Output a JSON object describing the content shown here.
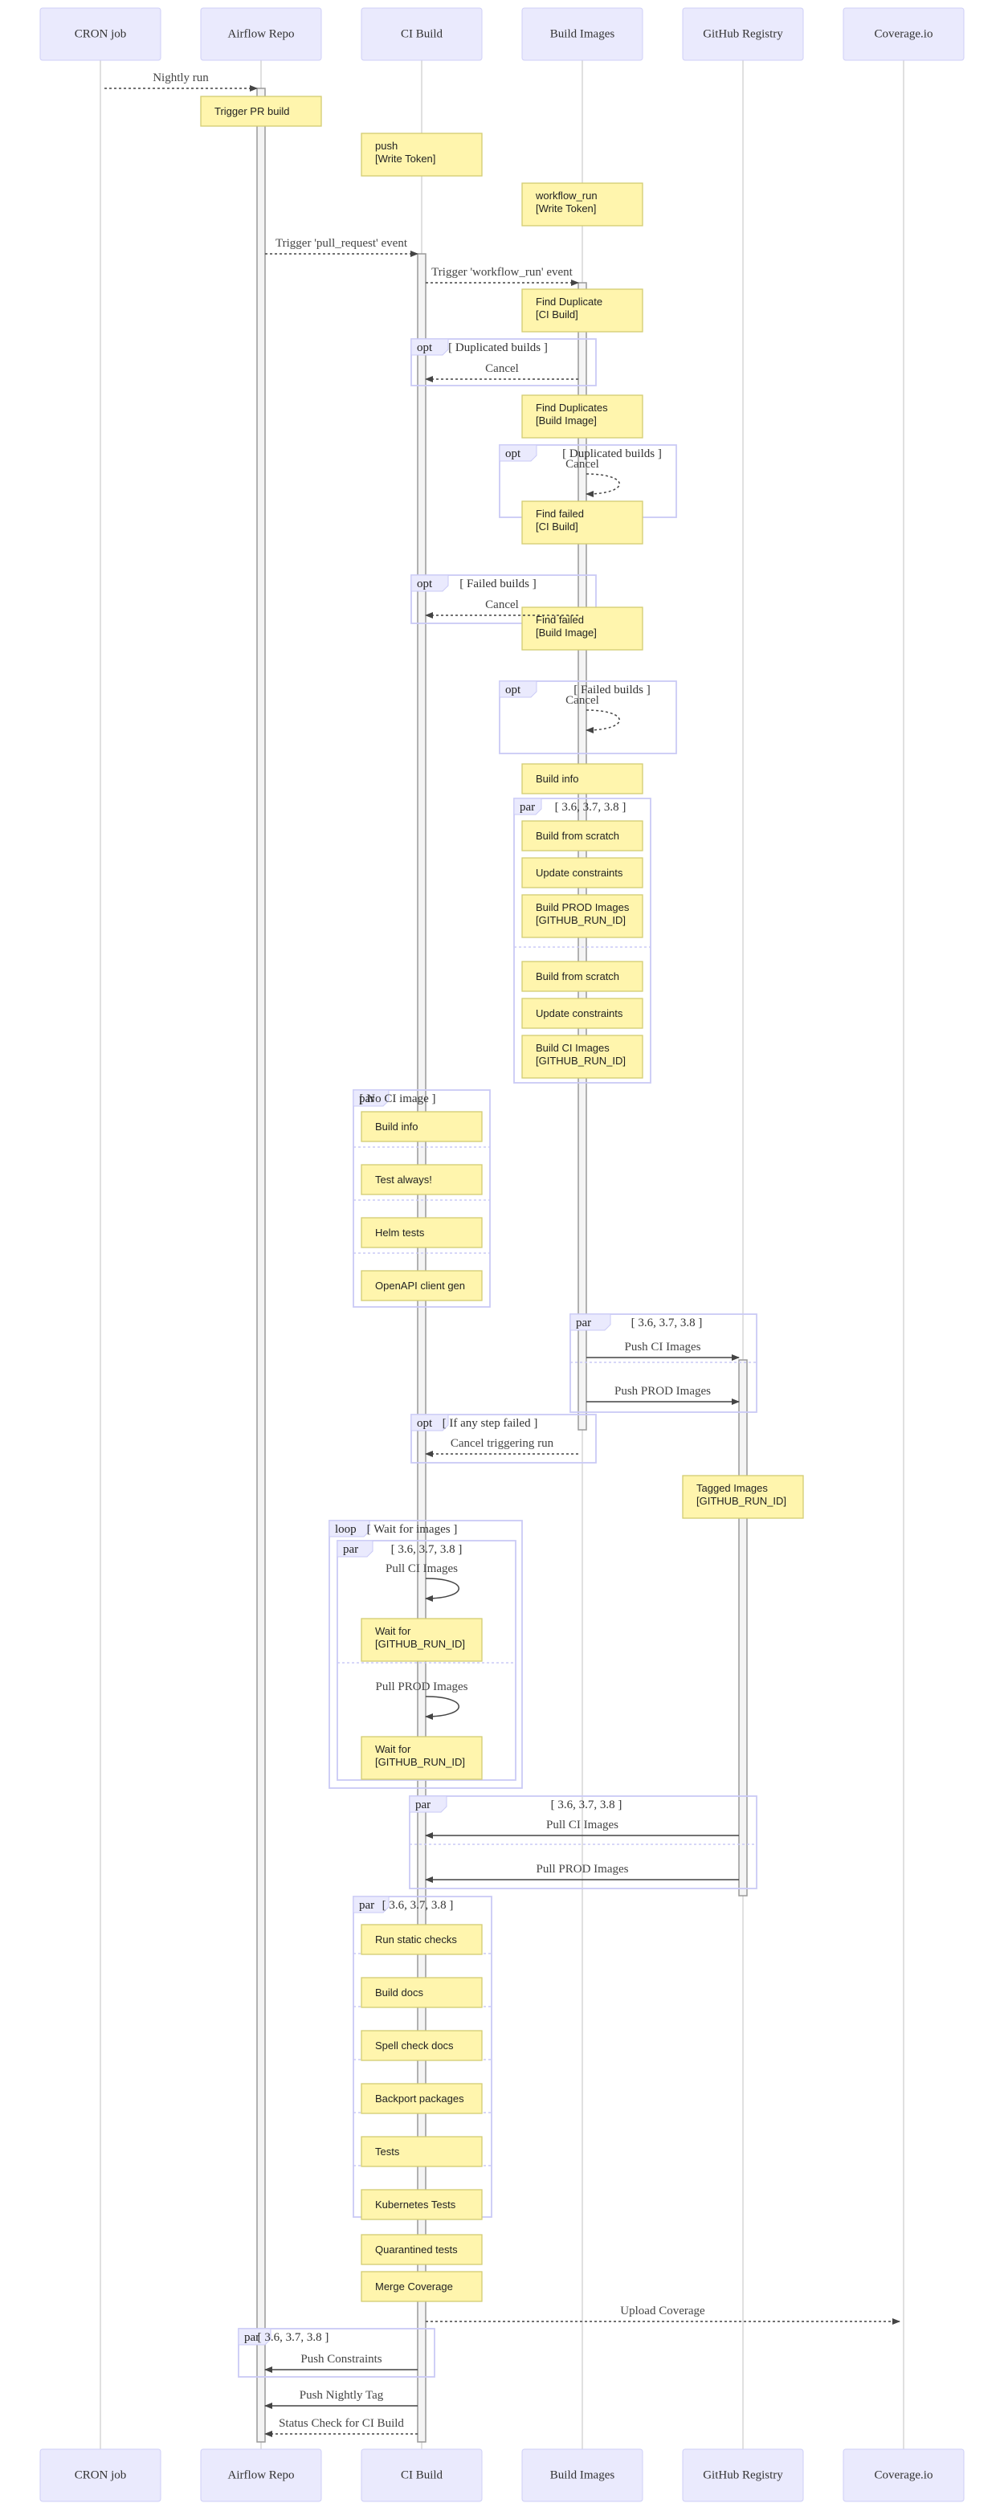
{
  "diagram": {
    "type": "sequence",
    "participants": [
      {
        "id": "cron",
        "label": "CRON job"
      },
      {
        "id": "repo",
        "label": "Airflow Repo"
      },
      {
        "id": "ci",
        "label": "CI Build"
      },
      {
        "id": "img",
        "label": "Build Images"
      },
      {
        "id": "reg",
        "label": "GitHub Registry"
      },
      {
        "id": "cov",
        "label": "Coverage.io"
      }
    ],
    "colors": {
      "actor_fill": "#eaeafd",
      "note_fill": "#fff5ad",
      "frame_stroke": "#cacaf6",
      "message_line": "#444444"
    },
    "messages": [
      {
        "from": "cron",
        "to": "repo",
        "label": "Nightly run",
        "style": "dotted"
      },
      {
        "from": "repo",
        "to": "ci",
        "label": "Trigger 'pull_request' event",
        "style": "dotted"
      },
      {
        "from": "ci",
        "to": "img",
        "label": "Trigger 'workflow_run' event",
        "style": "dotted"
      },
      {
        "from": "img",
        "to": "ci",
        "label": "Cancel",
        "style": "dotted"
      },
      {
        "from": "img",
        "to": "img",
        "label": "Cancel",
        "style": "dotted"
      },
      {
        "from": "img",
        "to": "ci",
        "label": "Cancel",
        "style": "dotted"
      },
      {
        "from": "img",
        "to": "img",
        "label": "Cancel",
        "style": "dotted"
      },
      {
        "from": "img",
        "to": "reg",
        "label": "Push CI Images",
        "style": "solid"
      },
      {
        "from": "img",
        "to": "reg",
        "label": "Push PROD Images",
        "style": "solid"
      },
      {
        "from": "img",
        "to": "ci",
        "label": "Cancel triggering run",
        "style": "dotted"
      },
      {
        "from": "ci",
        "to": "ci",
        "label": "Pull CI Images",
        "style": "solid"
      },
      {
        "from": "ci",
        "to": "ci",
        "label": "Pull PROD Images",
        "style": "solid"
      },
      {
        "from": "reg",
        "to": "ci",
        "label": "Pull CI Images",
        "style": "solid"
      },
      {
        "from": "reg",
        "to": "ci",
        "label": "Pull PROD Images",
        "style": "solid"
      },
      {
        "from": "ci",
        "to": "cov",
        "label": "Upload Coverage",
        "style": "dotted"
      },
      {
        "from": "ci",
        "to": "repo",
        "label": "Push Constraints",
        "style": "solid"
      },
      {
        "from": "ci",
        "to": "repo",
        "label": "Push Nightly Tag",
        "style": "solid"
      },
      {
        "from": "ci",
        "to": "repo",
        "label": "Status Check for CI Build",
        "style": "dotted"
      }
    ],
    "notes": [
      {
        "over": "repo",
        "lines": [
          "Trigger PR build"
        ]
      },
      {
        "over": "ci",
        "lines": [
          "push",
          "[Write Token]"
        ]
      },
      {
        "over": "img",
        "lines": [
          "workflow_run",
          "[Write Token]"
        ]
      },
      {
        "over": "img",
        "lines": [
          "Find Duplicate",
          "[CI Build]"
        ]
      },
      {
        "over": "img",
        "lines": [
          "Find Duplicates",
          "[Build Image]"
        ]
      },
      {
        "over": "img",
        "lines": [
          "Find failed",
          "[CI Build]"
        ]
      },
      {
        "over": "img",
        "lines": [
          "Find failed",
          "[Build Image]"
        ]
      },
      {
        "over": "img",
        "lines": [
          "Build info"
        ]
      },
      {
        "over": "img",
        "lines": [
          "Build from scratch"
        ]
      },
      {
        "over": "img",
        "lines": [
          "Update constraints"
        ]
      },
      {
        "over": "img",
        "lines": [
          "Build PROD Images",
          "[GITHUB_RUN_ID]"
        ]
      },
      {
        "over": "img",
        "lines": [
          "Build from scratch"
        ]
      },
      {
        "over": "img",
        "lines": [
          "Update constraints"
        ]
      },
      {
        "over": "img",
        "lines": [
          "Build CI Images",
          "[GITHUB_RUN_ID]"
        ]
      },
      {
        "over": "ci",
        "lines": [
          "Build info"
        ]
      },
      {
        "over": "ci",
        "lines": [
          "Test always!"
        ]
      },
      {
        "over": "ci",
        "lines": [
          "Helm tests"
        ]
      },
      {
        "over": "ci",
        "lines": [
          "OpenAPI client gen"
        ]
      },
      {
        "over": "reg",
        "lines": [
          "Tagged Images",
          "[GITHUB_RUN_ID]"
        ]
      },
      {
        "over": "ci",
        "lines": [
          "Wait for",
          "[GITHUB_RUN_ID]"
        ]
      },
      {
        "over": "ci",
        "lines": [
          "Wait for",
          "[GITHUB_RUN_ID]"
        ]
      },
      {
        "over": "ci",
        "lines": [
          "Run static checks"
        ]
      },
      {
        "over": "ci",
        "lines": [
          "Build docs"
        ]
      },
      {
        "over": "ci",
        "lines": [
          "Spell check docs"
        ]
      },
      {
        "over": "ci",
        "lines": [
          "Backport packages"
        ]
      },
      {
        "over": "ci",
        "lines": [
          "Tests"
        ]
      },
      {
        "over": "ci",
        "lines": [
          "Kubernetes Tests"
        ]
      },
      {
        "over": "ci",
        "lines": [
          "Quarantined tests"
        ]
      },
      {
        "over": "ci",
        "lines": [
          "Merge Coverage"
        ]
      }
    ],
    "frames": [
      {
        "kind": "opt",
        "condition": "[ Duplicated builds ]"
      },
      {
        "kind": "opt",
        "condition": "[ Duplicated builds ]"
      },
      {
        "kind": "opt",
        "condition": "[ Failed builds ]"
      },
      {
        "kind": "opt",
        "condition": "[ Failed builds ]"
      },
      {
        "kind": "par",
        "condition": "[ 3.6, 3.7, 3.8 ]"
      },
      {
        "kind": "par",
        "condition": "[ No CI image ]"
      },
      {
        "kind": "par",
        "condition": "[ 3.6, 3.7, 3.8 ]"
      },
      {
        "kind": "opt",
        "condition": "[ If any step failed ]"
      },
      {
        "kind": "loop",
        "condition": "[ Wait for images ]"
      },
      {
        "kind": "par",
        "condition": "[ 3.6, 3.7, 3.8 ]"
      },
      {
        "kind": "par",
        "condition": "[ 3.6, 3.7, 3.8 ]"
      },
      {
        "kind": "par",
        "condition": "[ 3.6, 3.7, 3.8 ]"
      },
      {
        "kind": "par",
        "condition": "[ 3.6, 3.7, 3.8 ]"
      }
    ]
  }
}
